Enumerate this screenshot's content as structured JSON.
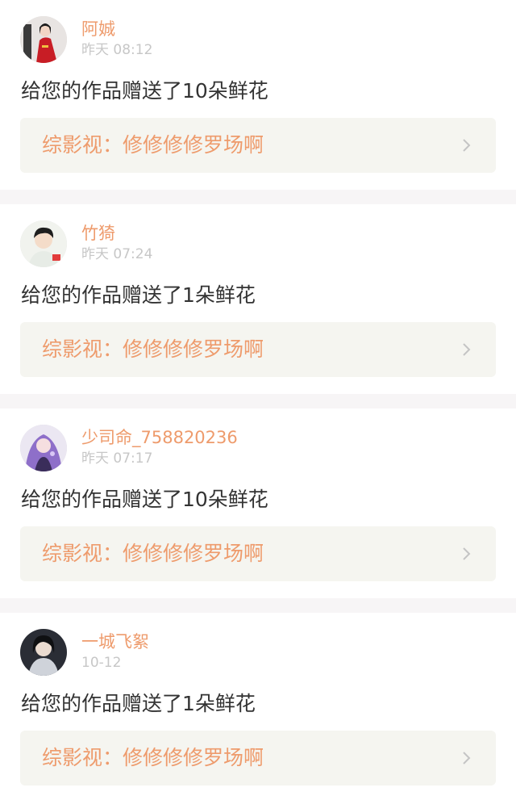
{
  "notifications": [
    {
      "username": "阿娍",
      "time": "昨天 08:12",
      "message": "给您的作品赠送了10朵鲜花",
      "work_title": "综影视：修修修修罗场啊",
      "avatar_icon": "avatar-red-robe"
    },
    {
      "username": "竹猗",
      "time": "昨天 07:24",
      "message": "给您的作品赠送了1朵鲜花",
      "work_title": "综影视：修修修修罗场啊",
      "avatar_icon": "avatar-young-man"
    },
    {
      "username": "少司命_758820236",
      "time": "昨天 07:17",
      "message": "给您的作品赠送了10朵鲜花",
      "work_title": "综影视：修修修修罗场啊",
      "avatar_icon": "avatar-purple-hair"
    },
    {
      "username": "一城飞絮",
      "time": "10-12",
      "message": "给您的作品赠送了1朵鲜花",
      "work_title": "综影视：修修修修罗场啊",
      "avatar_icon": "avatar-dark-hair"
    }
  ],
  "colors": {
    "username": "#ee9b6c",
    "timestamp": "#c7c7c7",
    "message": "#333333",
    "link_bg": "#f5f5f0",
    "separator": "#f7f5f6",
    "tab_indicator": "#e9869f"
  }
}
